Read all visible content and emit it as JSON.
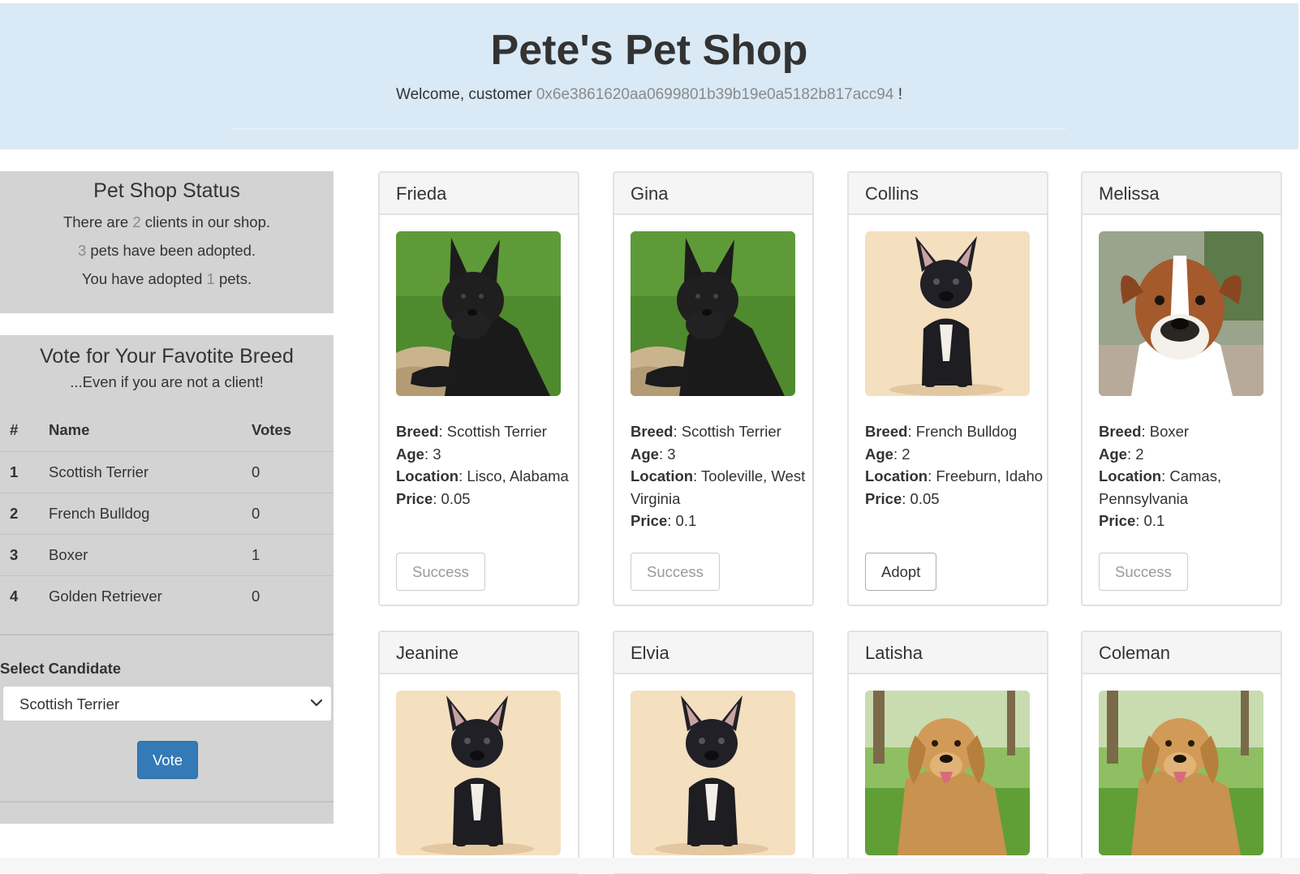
{
  "header": {
    "title": "Pete's Pet Shop",
    "welcome_prefix": "Welcome, customer ",
    "customer_address": "0x6e3861620aa0699801b39b19e0a5182b817acc94",
    "welcome_suffix": " !"
  },
  "status": {
    "title": "Pet Shop Status",
    "line1_prefix": "There are ",
    "clients": "2",
    "line1_suffix": " clients in our shop.",
    "adopted_total": "3",
    "line2_suffix": " pets have been adopted.",
    "line3_prefix": "You have adopted ",
    "adopted_mine": "1",
    "line3_suffix": " pets."
  },
  "vote": {
    "title": "Vote for Your Favotite Breed",
    "subtitle": "...Even if you are not a client!",
    "columns": [
      "#",
      "Name",
      "Votes"
    ],
    "rows": [
      {
        "num": "1",
        "name": "Scottish Terrier",
        "votes": "0"
      },
      {
        "num": "2",
        "name": "French Bulldog",
        "votes": "0"
      },
      {
        "num": "3",
        "name": "Boxer",
        "votes": "1"
      },
      {
        "num": "4",
        "name": "Golden Retriever",
        "votes": "0"
      }
    ],
    "select_label": "Select Candidate",
    "select_value": "Scottish Terrier",
    "button_label": "Vote"
  },
  "labels": {
    "breed": "Breed",
    "age": "Age",
    "location": "Location",
    "price": "Price",
    "sep": ": "
  },
  "pets": [
    {
      "name": "Frieda",
      "breed": "Scottish Terrier",
      "age": "3",
      "location": "Lisco, Alabama",
      "price": "0.05",
      "button": "Success",
      "state": "done",
      "image": "scottish-terrier"
    },
    {
      "name": "Gina",
      "breed": "Scottish Terrier",
      "age": "3",
      "location": "Tooleville, West Virginia",
      "price": "0.1",
      "button": "Success",
      "state": "done",
      "image": "scottish-terrier"
    },
    {
      "name": "Collins",
      "breed": "French Bulldog",
      "age": "2",
      "location": "Freeburn, Idaho",
      "price": "0.05",
      "button": "Adopt",
      "state": "live",
      "image": "french-bulldog"
    },
    {
      "name": "Melissa",
      "breed": "Boxer",
      "age": "2",
      "location": "Camas, Pennsylvania",
      "price": "0.1",
      "button": "Success",
      "state": "done",
      "image": "boxer"
    },
    {
      "name": "Jeanine",
      "image": "french-bulldog"
    },
    {
      "name": "Elvia",
      "image": "french-bulldog"
    },
    {
      "name": "Latisha",
      "image": "golden-retriever"
    },
    {
      "name": "Coleman",
      "image": "golden-retriever"
    }
  ],
  "colors": {
    "jumbotron": "#d9e9f6",
    "panel": "#d3d3d3",
    "primary": "#337ab7",
    "muted": "#8a8a8a"
  }
}
